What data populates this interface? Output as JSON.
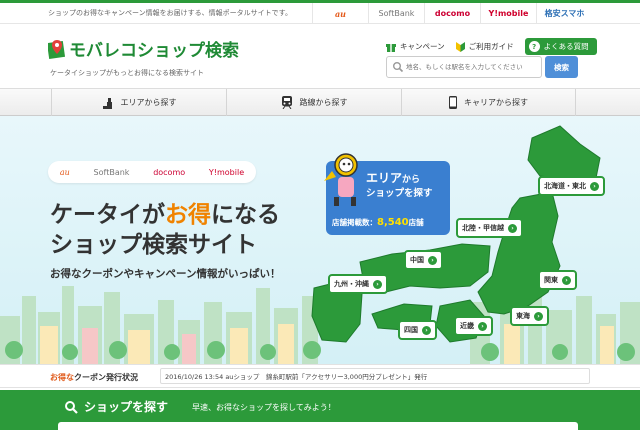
{
  "topbar": {
    "tagline": "ショップのお得なキャンペーン情報をお届けする、情報ポータルサイトです。",
    "carriers": [
      "au",
      "SoftBank",
      "docomo",
      "Y!mobile",
      "格安スマホ"
    ]
  },
  "header": {
    "logo_text": "モバレコショップ検索",
    "subtitle": "ケータイショップがもっとお得になる検索サイト",
    "campaign_link": "キャンペーン",
    "guide_link": "ご利用ガイド",
    "faq_button": "よくある質問",
    "search_placeholder": "地名、もしくは駅名を入力してください",
    "search_button": "検索"
  },
  "nav": {
    "area": "エリアから探す",
    "route": "路線から探す",
    "carrier": "キャリアから探す"
  },
  "hero": {
    "carriers": [
      "au",
      "SoftBank",
      "docomo",
      "Y!mobile"
    ],
    "headline_pre": "ケータイが",
    "headline_highlight": "お得",
    "headline_post": "になる",
    "headline_line2": "ショップ検索サイト",
    "tagline": "お得なクーポンやキャンペーン情報がいっぱい！",
    "area_bubble_line1a": "エリア",
    "area_bubble_line1b": "から",
    "area_bubble_line2": "ショップを探す",
    "shop_count_label": "店舗掲載数：",
    "shop_count": "8,540",
    "shop_count_unit": "店舗",
    "regions": {
      "hokkaido": "北海道・東北",
      "hokuriku": "北陸・甲信越",
      "chugoku": "中国",
      "kanto": "関東",
      "kyushu": "九州・沖縄",
      "tokai": "東海",
      "shikoku": "四国",
      "kinki": "近畿"
    }
  },
  "news": {
    "label_highlight": "お得な",
    "label_rest": "クーポン発行状況",
    "item": "2016/10/26 13:54 auショップ　錦糸町駅前「アクセサリー3,000円分プレゼント」発行"
  },
  "search_section": {
    "title": "ショップを探す",
    "subtitle": "早速、お得なショップを探してみよう！"
  },
  "colors": {
    "brand_green": "#2c9a3a",
    "accent_orange": "#f08300",
    "search_blue": "#4f8fd8"
  }
}
